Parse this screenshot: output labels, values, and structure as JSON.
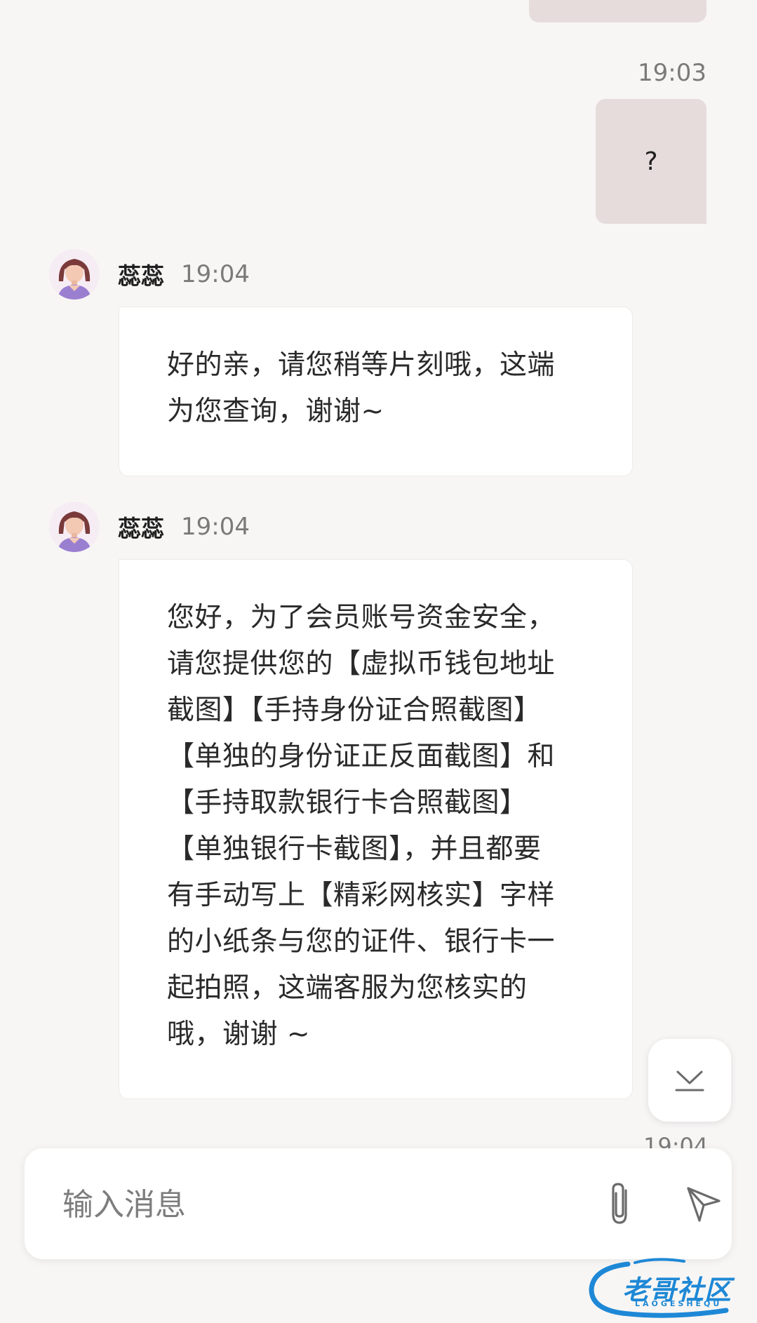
{
  "conversation": {
    "outgoing": [
      {
        "time": "19:03",
        "text": "?"
      }
    ],
    "incoming": [
      {
        "sender": "蕊蕊",
        "time": "19:04",
        "lines": [
          "好的亲，请您稍等片刻哦，这端",
          "为您查询，谢谢~"
        ]
      },
      {
        "sender": "蕊蕊",
        "time": "19:04",
        "lines": [
          "您好，为了会员账号资金安全，",
          "请您提供您的【虚拟币钱包地址",
          "截图】【手持身份证合照截图】",
          "【单独的身份证正反面截图】和",
          "【手持取款银行卡合照截图】",
          "【单独银行卡截图】，并且都要",
          "有手动写上【精彩网核实】字样",
          "的小纸条与您的证件、银行卡一",
          "起拍照，这端客服为您核实的",
          "哦，谢谢 ~"
        ]
      }
    ],
    "next_time_partial": "19:04"
  },
  "input_bar": {
    "placeholder": "输入消息",
    "attach_icon": "paperclip-icon",
    "send_icon": "send-icon"
  },
  "scroll_button": {
    "icon": "scroll-to-bottom-icon"
  },
  "watermark": {
    "title": "老哥社区",
    "subtitle": "LAOGESHEQU"
  },
  "colors": {
    "background": "#f8f6f5",
    "outgoing_bubble": "#e6dcdc",
    "incoming_bubble": "#ffffff",
    "timestamp": "#7a7a7a",
    "watermark": "#1e88d6"
  }
}
